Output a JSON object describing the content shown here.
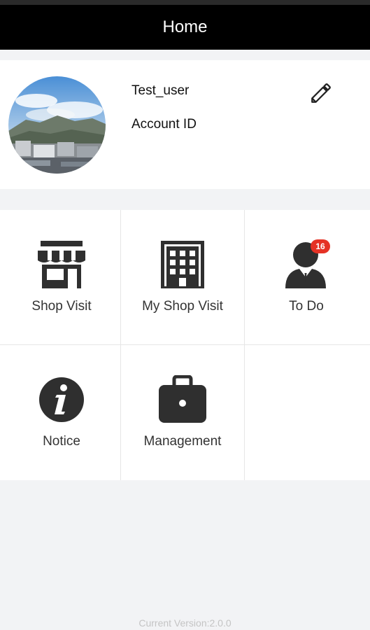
{
  "header": {
    "title": "Home"
  },
  "profile": {
    "username": "Test_user",
    "account_id_label": "Account ID",
    "avatar_icon": "mountain-city-photo",
    "edit_icon": "pencil-icon"
  },
  "menu": {
    "items": [
      {
        "label": "Shop Visit",
        "icon": "storefront-icon"
      },
      {
        "label": "My Shop Visit",
        "icon": "building-icon"
      },
      {
        "label": "To Do",
        "icon": "person-icon",
        "badge": "16"
      },
      {
        "label": "Notice",
        "icon": "info-icon"
      },
      {
        "label": "Management",
        "icon": "briefcase-icon"
      }
    ]
  },
  "footer": {
    "version": "Current Version:2.0.0"
  },
  "colors": {
    "header_bg": "#000000",
    "badge": "#e53225",
    "icon": "#2f2f2f",
    "background": "#f2f3f5"
  }
}
